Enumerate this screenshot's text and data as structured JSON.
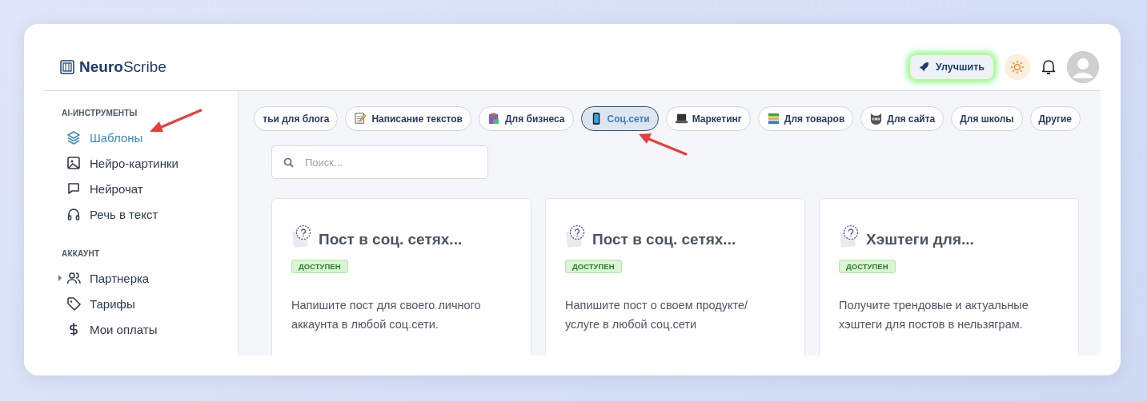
{
  "logo": {
    "bold": "Neuro",
    "light": "Scribe"
  },
  "header": {
    "upgrade_button": "Улучшить"
  },
  "sidebar": {
    "sections": [
      {
        "title": "AI-ИНСТРУМЕНТЫ",
        "items": [
          {
            "label": "Шаблоны",
            "kind": "layers",
            "selected": true,
            "pointer": true
          },
          {
            "label": "Нейро-картинки",
            "kind": "image",
            "selected": false
          },
          {
            "label": "Нейрочат",
            "kind": "chat",
            "selected": false
          },
          {
            "label": "Речь в текст",
            "kind": "headphones",
            "selected": false
          }
        ]
      },
      {
        "title": "АККАУНТ",
        "items": [
          {
            "label": "Партнерка",
            "kind": "users",
            "selected": false,
            "expandable": true
          },
          {
            "label": "Тарифы",
            "kind": "tag",
            "selected": false
          },
          {
            "label": "Мои оплаты",
            "kind": "dollar",
            "selected": false
          }
        ]
      }
    ]
  },
  "categories": [
    {
      "label": "тьи для блога",
      "kind": "plain",
      "selected": false
    },
    {
      "label": "Написание текстов",
      "kind": "memo",
      "selected": false
    },
    {
      "label": "Для бизнеса",
      "kind": "clipboard",
      "selected": false
    },
    {
      "label": "Соц.сети",
      "kind": "phone",
      "selected": true,
      "pointer": true
    },
    {
      "label": "Маркетинг",
      "kind": "laptop",
      "selected": false
    },
    {
      "label": "Для товаров",
      "kind": "books",
      "selected": false
    },
    {
      "label": "Для сайта",
      "kind": "cat",
      "selected": false
    },
    {
      "label": "Для школы",
      "kind": "plain",
      "selected": false
    },
    {
      "label": "Другие",
      "kind": "plain",
      "selected": false
    }
  ],
  "search": {
    "placeholder": "Поиск..."
  },
  "templates": [
    {
      "title": "Пост в соц. сетях...",
      "badge": "ДОСТУПЕН",
      "description": "Напишите пост для своего личного аккаунта в любой соц.сети."
    },
    {
      "title": "Пост в соц. сетях...",
      "badge": "ДОСТУПЕН",
      "description": "Напишите пост о своем продукте/ услуге в любой соц.сети"
    },
    {
      "title": "Хэштеги для...",
      "badge": "ДОСТУПЕН",
      "description": "Получите трендовые и актуальные хэштеги для постов в нельзяграм."
    }
  ]
}
